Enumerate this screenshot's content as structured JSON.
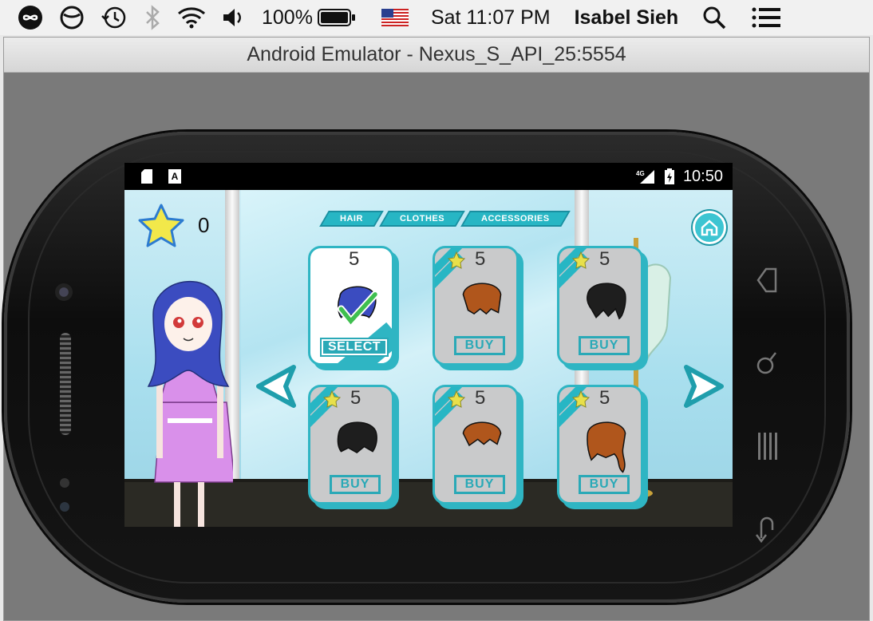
{
  "menubar": {
    "battery_percent": "100%",
    "clock": "Sat 11:07 PM",
    "user": "Isabel Sieh",
    "icons": [
      "infinity-icon",
      "no-entry-icon",
      "time-machine-icon",
      "bluetooth-icon",
      "wifi-icon",
      "volume-icon",
      "battery-icon",
      "us-flag-icon",
      "spotlight-search-icon",
      "menu-list-icon"
    ]
  },
  "window": {
    "title": "Android Emulator - Nexus_S_API_25:5554"
  },
  "android_status": {
    "network": "4G",
    "time": "10:50"
  },
  "game": {
    "star_count": "0",
    "tabs": [
      "HAIR",
      "CLOTHES",
      "ACCESSORIES"
    ],
    "items": [
      {
        "price": "5",
        "action": "SELECT",
        "state": "owned",
        "hair_color": "#3b4cc0"
      },
      {
        "price": "5",
        "action": "BUY",
        "state": "locked",
        "hair_color": "#b0561c"
      },
      {
        "price": "5",
        "action": "BUY",
        "state": "locked",
        "hair_color": "#1e1e1e"
      },
      {
        "price": "5",
        "action": "BUY",
        "state": "locked",
        "hair_color": "#1e1e1e"
      },
      {
        "price": "5",
        "action": "BUY",
        "state": "locked",
        "hair_color": "#b0561c"
      },
      {
        "price": "5",
        "action": "BUY",
        "state": "locked",
        "hair_color": "#b0561c"
      }
    ]
  },
  "colors": {
    "accent": "#2fb5c3",
    "star": "#f2e84a"
  }
}
